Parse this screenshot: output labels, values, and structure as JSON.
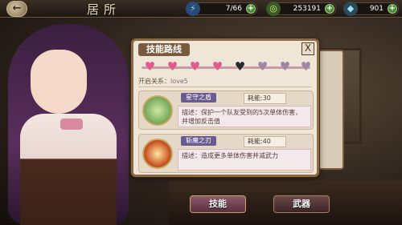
{
  "header": {
    "back_label": "←",
    "title": "居所",
    "stamina": {
      "value": "7/66",
      "icon": "lightning-icon"
    },
    "gold": {
      "value": "253191",
      "icon": "coin-icon"
    },
    "gems": {
      "value": "901",
      "icon": "gem-icon"
    },
    "plus_label": "+"
  },
  "dialog": {
    "title": "技能路线",
    "close_label": "X",
    "path": {
      "nodes": [
        {
          "state": "on"
        },
        {
          "state": "on"
        },
        {
          "state": "on"
        },
        {
          "state": "on"
        },
        {
          "state": "selected"
        },
        {
          "state": "off"
        },
        {
          "state": "off"
        },
        {
          "state": "off"
        }
      ]
    },
    "relation_label": "开启关系：",
    "relation_value": "love5",
    "skills": [
      {
        "name": "星守之盾",
        "cost_label": "耗能",
        "cost_value": ":30",
        "desc_label": "描述：",
        "desc": "保护一个队友受到的5次单体伤害，并增加反击值",
        "icon": "shield-guard-icon"
      },
      {
        "name": "斩魔之刃",
        "cost_label": "耗能",
        "cost_value": ":40",
        "desc_label": "描述：",
        "desc": "造成更多单体伤害并减武力",
        "icon": "slash-attack-icon"
      }
    ]
  },
  "tabs": {
    "skill": "技能",
    "weapon": "武器"
  },
  "colors": {
    "accent": "#e15a8c",
    "frame": "#8a6a44"
  }
}
